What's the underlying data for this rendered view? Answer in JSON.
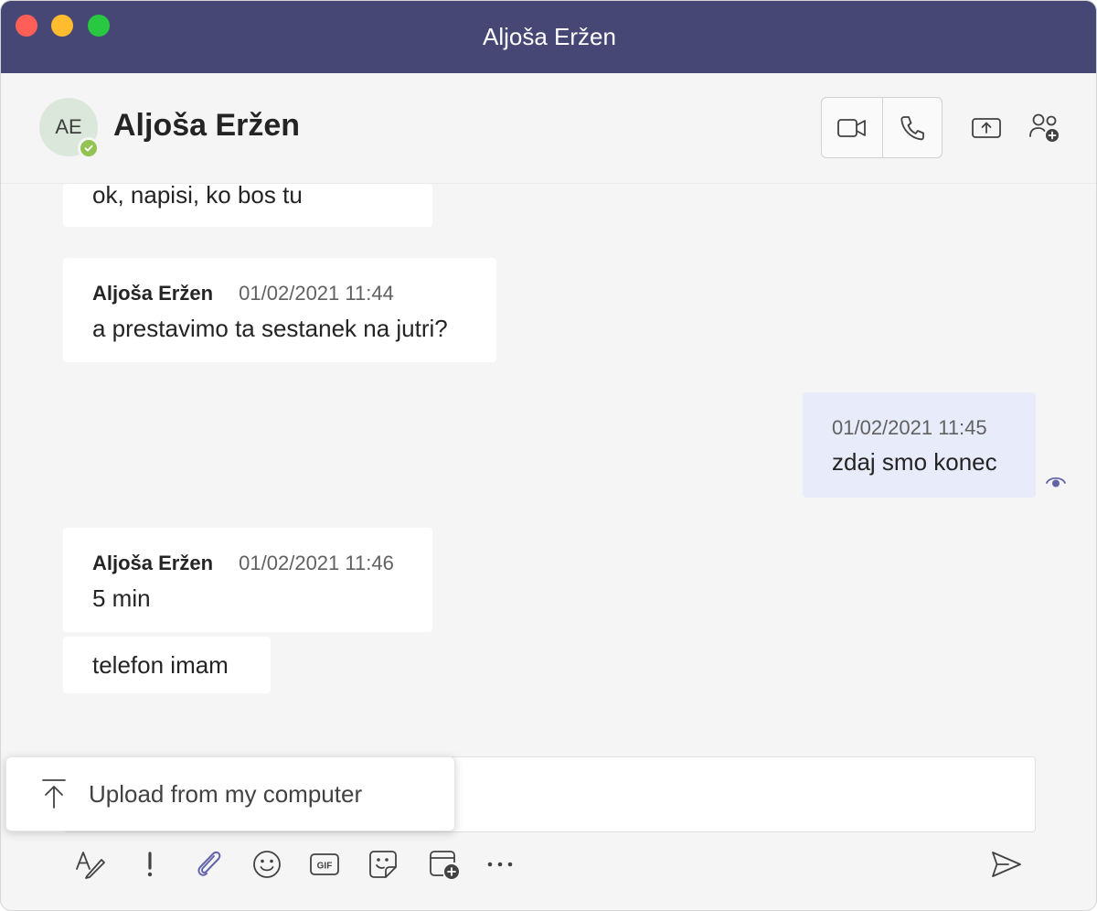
{
  "window": {
    "title": "Aljoša Eržen"
  },
  "header": {
    "avatar_initials": "AE",
    "contact_name": "Aljoša Eržen",
    "presence_color": "#92c353"
  },
  "messages": [
    {
      "author": "",
      "time": "",
      "text": "ok, napisi, ko bos tu",
      "mine": false
    },
    {
      "author": "Aljoša Eržen",
      "time": "01/02/2021 11:44",
      "text": "a prestavimo ta sestanek na jutri?",
      "mine": false
    },
    {
      "author": "",
      "time": "01/02/2021 11:45",
      "text": "zdaj smo konec",
      "mine": true
    },
    {
      "author": "Aljoša Eržen",
      "time": "01/02/2021 11:46",
      "text": "5 min",
      "mine": false
    },
    {
      "author": "",
      "time": "",
      "text": "telefon imam",
      "mine": false
    }
  ],
  "upload_menu": {
    "label": "Upload from my computer"
  },
  "toolbar": {
    "gif_label": "GIF"
  },
  "colors": {
    "titlebar": "#464775",
    "accent": "#6264a7",
    "own_message": "#e8ebfa"
  },
  "icons": {
    "video_call": "video-camera-icon",
    "audio_call": "phone-icon",
    "share": "share-screen-icon",
    "add_people": "add-people-icon",
    "seen": "eye-icon",
    "upload": "upload-arrow-icon",
    "format": "format-text-icon",
    "important": "exclamation-icon",
    "attach": "paperclip-icon",
    "emoji": "smiley-icon",
    "gif": "gif-icon",
    "sticker": "sticker-icon",
    "schedule": "schedule-meeting-icon",
    "more": "ellipsis-icon",
    "send": "send-icon"
  }
}
